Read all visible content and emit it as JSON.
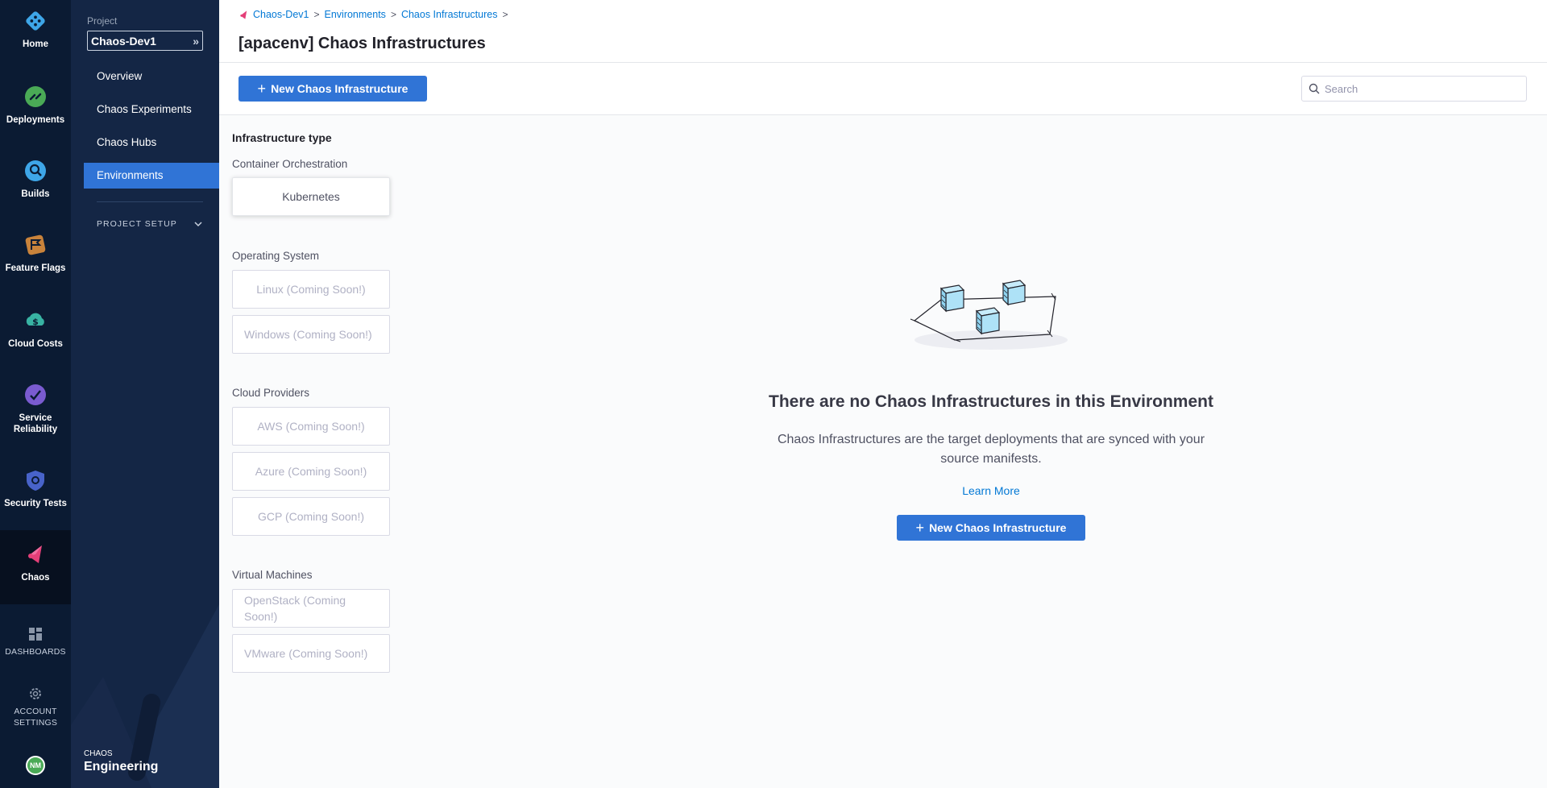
{
  "rail": {
    "items": [
      {
        "label": "Home"
      },
      {
        "label": "Deployments"
      },
      {
        "label": "Builds"
      },
      {
        "label": "Feature Flags"
      },
      {
        "label": "Cloud Costs"
      },
      {
        "label": "Service Reliability"
      },
      {
        "label": "Security Tests"
      },
      {
        "label": "Chaos"
      }
    ],
    "dashboards": "DASHBOARDS",
    "account_settings": "ACCOUNT SETTINGS",
    "avatar": "NM"
  },
  "nav": {
    "project_label": "Project",
    "project_value": "Chaos-Dev1",
    "items": [
      {
        "label": "Overview"
      },
      {
        "label": "Chaos Experiments"
      },
      {
        "label": "Chaos Hubs"
      },
      {
        "label": "Environments"
      }
    ],
    "project_setup": "PROJECT SETUP",
    "brand_top": "CHAOS",
    "brand_bottom": "Engineering"
  },
  "header": {
    "breadcrumbs": [
      "Chaos-Dev1",
      "Environments",
      "Chaos Infrastructures"
    ],
    "title": "[apacenv] Chaos Infrastructures"
  },
  "toolbar": {
    "new_button": "New Chaos Infrastructure",
    "search_placeholder": "Search"
  },
  "filters": {
    "heading": "Infrastructure type",
    "groups": [
      {
        "label": "Container Orchestration",
        "options": [
          "Kubernetes"
        ]
      },
      {
        "label": "Operating System",
        "options": [
          "Linux (Coming Soon!)",
          "Windows (Coming Soon!)"
        ]
      },
      {
        "label": "Cloud Providers",
        "options": [
          "AWS (Coming Soon!)",
          "Azure (Coming Soon!)",
          "GCP (Coming Soon!)"
        ]
      },
      {
        "label": "Virtual Machines",
        "options": [
          "OpenStack (Coming Soon!)",
          "VMware (Coming Soon!)"
        ]
      }
    ]
  },
  "empty_state": {
    "title": "There are no Chaos Infrastructures in this Environment",
    "description": "Chaos Infrastructures are the target deployments that are synced with your source manifests.",
    "learn_more": "Learn More",
    "button": "New Chaos Infrastructure"
  },
  "colors": {
    "accent": "#3074d6",
    "rail_bg": "#0b1b33",
    "nav_bg": "#142645",
    "link": "#0278d5"
  }
}
